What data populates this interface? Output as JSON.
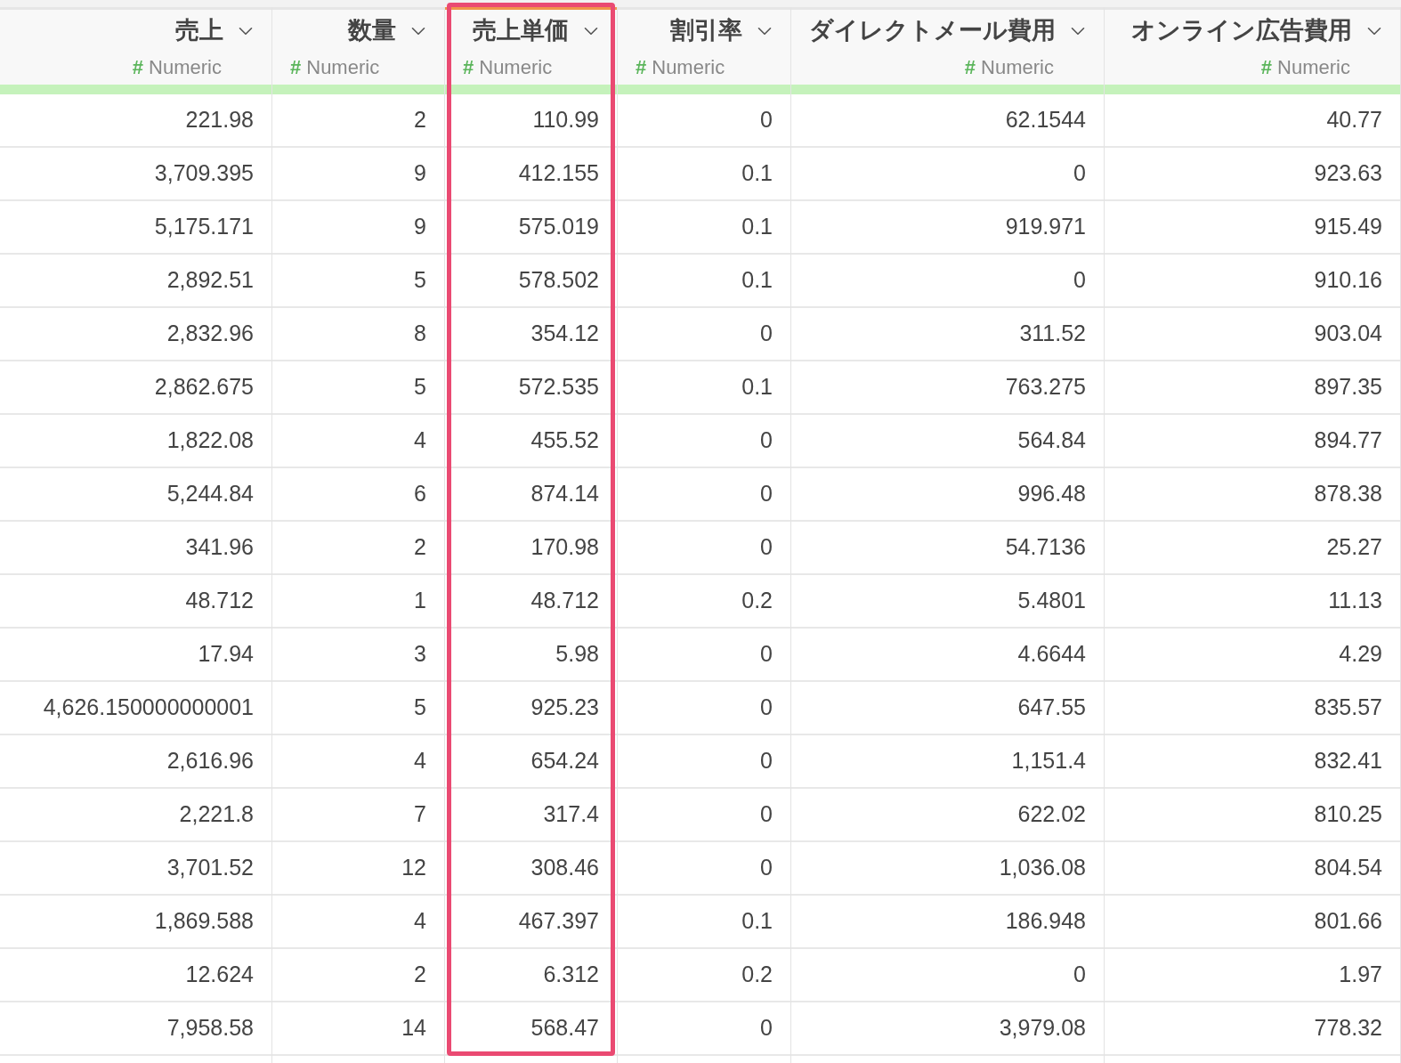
{
  "table": {
    "columns": [
      {
        "name": "売上",
        "type": "Numeric",
        "type_icon": "#",
        "selected": false
      },
      {
        "name": "数量",
        "type": "Numeric",
        "type_icon": "#",
        "selected": false
      },
      {
        "name": "売上単価",
        "type": "Numeric",
        "type_icon": "#",
        "selected": true
      },
      {
        "name": "割引率",
        "type": "Numeric",
        "type_icon": "#",
        "selected": false
      },
      {
        "name": "ダイレクトメール費用",
        "type": "Numeric",
        "type_icon": "#",
        "selected": false
      },
      {
        "name": "オンライン広告費用",
        "type": "Numeric",
        "type_icon": "#",
        "selected": false
      }
    ],
    "rows": [
      [
        "221.98",
        "2",
        "110.99",
        "0",
        "62.1544",
        "40.77"
      ],
      [
        "3,709.395",
        "9",
        "412.155",
        "0.1",
        "0",
        "923.63"
      ],
      [
        "5,175.171",
        "9",
        "575.019",
        "0.1",
        "919.971",
        "915.49"
      ],
      [
        "2,892.51",
        "5",
        "578.502",
        "0.1",
        "0",
        "910.16"
      ],
      [
        "2,832.96",
        "8",
        "354.12",
        "0",
        "311.52",
        "903.04"
      ],
      [
        "2,862.675",
        "5",
        "572.535",
        "0.1",
        "763.275",
        "897.35"
      ],
      [
        "1,822.08",
        "4",
        "455.52",
        "0",
        "564.84",
        "894.77"
      ],
      [
        "5,244.84",
        "6",
        "874.14",
        "0",
        "996.48",
        "878.38"
      ],
      [
        "341.96",
        "2",
        "170.98",
        "0",
        "54.7136",
        "25.27"
      ],
      [
        "48.712",
        "1",
        "48.712",
        "0.2",
        "5.4801",
        "11.13"
      ],
      [
        "17.94",
        "3",
        "5.98",
        "0",
        "4.6644",
        "4.29"
      ],
      [
        "4,626.150000000001",
        "5",
        "925.23",
        "0",
        "647.55",
        "835.57"
      ],
      [
        "2,616.96",
        "4",
        "654.24",
        "0",
        "1,151.4",
        "832.41"
      ],
      [
        "2,221.8",
        "7",
        "317.4",
        "0",
        "622.02",
        "810.25"
      ],
      [
        "3,701.52",
        "12",
        "308.46",
        "0",
        "1,036.08",
        "804.54"
      ],
      [
        "1,869.588",
        "4",
        "467.397",
        "0.1",
        "186.948",
        "801.66"
      ],
      [
        "12.624",
        "2",
        "6.312",
        "0.2",
        "0",
        "1.97"
      ],
      [
        "7,958.58",
        "14",
        "568.47",
        "0",
        "3,979.08",
        "778.32"
      ]
    ]
  }
}
